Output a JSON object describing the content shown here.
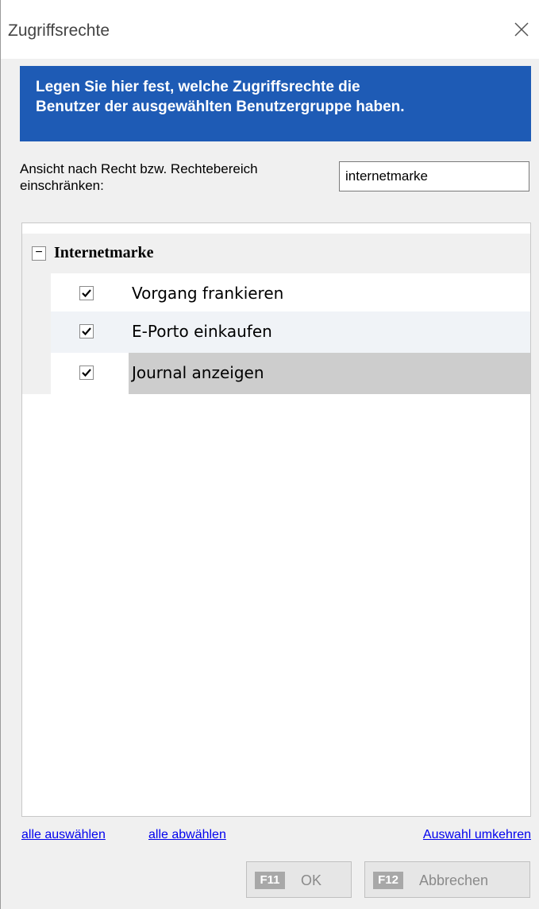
{
  "window": {
    "title": "Zugriffsrechte"
  },
  "banner": {
    "line1": "Legen Sie hier fest, welche Zugriffsrechte die",
    "line2": "Benutzer der ausgewählten Benutzergruppe haben."
  },
  "filter": {
    "label_line1": "Ansicht nach Recht bzw. Rechtebereich",
    "label_line2": "einschränken:",
    "value": "internetmarke"
  },
  "tree": {
    "group": {
      "expander": "−",
      "label": "Internetmarke",
      "expanded": true
    },
    "items": [
      {
        "label": "Vorgang frankieren",
        "checked": true
      },
      {
        "label": "E-Porto einkaufen",
        "checked": true
      },
      {
        "label": "Journal anzeigen",
        "checked": true,
        "selected": true
      }
    ]
  },
  "links": {
    "select_all": "alle auswählen",
    "deselect_all": "alle abwählen",
    "invert": "Auswahl umkehren"
  },
  "buttons": {
    "ok": {
      "key": "F11",
      "label": "OK"
    },
    "cancel": {
      "key": "F12",
      "label": "Abbrechen"
    }
  },
  "colors": {
    "banner": "#1e5bb5",
    "link": "#0000ee",
    "selected_row": "#cdcdcd",
    "odd_row": "#ffffff",
    "even_row": "#f0f3f7"
  },
  "icons": {
    "close": "close-icon",
    "expander": "collapse-icon",
    "check": "checkmark-icon"
  }
}
